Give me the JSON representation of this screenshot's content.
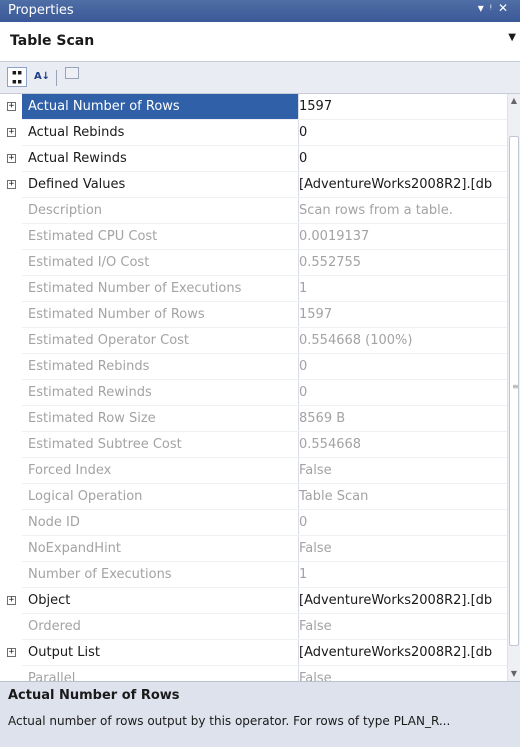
{
  "window": {
    "title": "Properties",
    "controls": [
      "▾",
      "ᚹ",
      "✕"
    ]
  },
  "object_selector": {
    "value": "Table Scan"
  },
  "toolbar": {
    "buttons": [
      "categorized-icon",
      "alphabetical-icon",
      "property-pages-icon"
    ],
    "alpha_glyph": "A↓"
  },
  "properties": [
    {
      "name": "Actual Number of Rows",
      "value": "1597",
      "expandable": true,
      "readonly": false,
      "selected": true
    },
    {
      "name": "Actual Rebinds",
      "value": "0",
      "expandable": true,
      "readonly": false
    },
    {
      "name": "Actual Rewinds",
      "value": "0",
      "expandable": true,
      "readonly": false
    },
    {
      "name": "Defined Values",
      "value": "[AdventureWorks2008R2].[db",
      "expandable": true,
      "readonly": false
    },
    {
      "name": "Description",
      "value": "Scan rows from a table.",
      "expandable": false,
      "readonly": true
    },
    {
      "name": "Estimated CPU Cost",
      "value": "0.0019137",
      "expandable": false,
      "readonly": true
    },
    {
      "name": "Estimated I/O Cost",
      "value": "0.552755",
      "expandable": false,
      "readonly": true
    },
    {
      "name": "Estimated Number of Executions",
      "value": "1",
      "expandable": false,
      "readonly": true
    },
    {
      "name": "Estimated Number of Rows",
      "value": "1597",
      "expandable": false,
      "readonly": true
    },
    {
      "name": "Estimated Operator Cost",
      "value": "0.554668 (100%)",
      "expandable": false,
      "readonly": true
    },
    {
      "name": "Estimated Rebinds",
      "value": "0",
      "expandable": false,
      "readonly": true
    },
    {
      "name": "Estimated Rewinds",
      "value": "0",
      "expandable": false,
      "readonly": true
    },
    {
      "name": "Estimated Row Size",
      "value": "8569 B",
      "expandable": false,
      "readonly": true
    },
    {
      "name": "Estimated Subtree Cost",
      "value": "0.554668",
      "expandable": false,
      "readonly": true
    },
    {
      "name": "Forced Index",
      "value": "False",
      "expandable": false,
      "readonly": true
    },
    {
      "name": "Logical Operation",
      "value": "Table Scan",
      "expandable": false,
      "readonly": true
    },
    {
      "name": "Node ID",
      "value": "0",
      "expandable": false,
      "readonly": true
    },
    {
      "name": "NoExpandHint",
      "value": "False",
      "expandable": false,
      "readonly": true
    },
    {
      "name": "Number of Executions",
      "value": "1",
      "expandable": false,
      "readonly": true
    },
    {
      "name": "Object",
      "value": "[AdventureWorks2008R2].[db",
      "expandable": true,
      "readonly": false
    },
    {
      "name": "Ordered",
      "value": "False",
      "expandable": false,
      "readonly": true
    },
    {
      "name": "Output List",
      "value": "[AdventureWorks2008R2].[db",
      "expandable": true,
      "readonly": false
    },
    {
      "name": "Parallel",
      "value": "False",
      "expandable": false,
      "readonly": true
    }
  ],
  "description_panel": {
    "title": "Actual Number of Rows",
    "text": "Actual number of rows output by this operator. For rows of type PLAN_R..."
  }
}
